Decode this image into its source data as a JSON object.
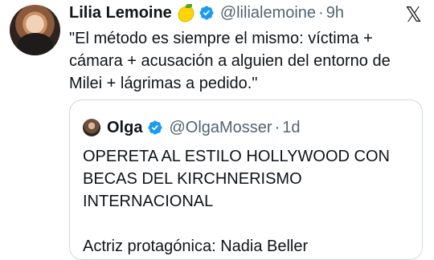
{
  "tweet": {
    "author_name": "Lilia Lemoine",
    "handle": "@lilialemoine",
    "separator": "·",
    "time": "9h",
    "text": "\"El método es siempre el mismo: víctima + cámara + acusación a alguien del entorno de Milei + lágrimas a pedido.\"",
    "badge_emoji": "lemon",
    "platform_logo": "𝕏"
  },
  "quoted_tweet": {
    "author_name": "Olga",
    "handle": "@OlgaMosser",
    "separator": "·",
    "time": "1d",
    "lines": [
      "OPERETA AL ESTILO HOLLYWOOD CON",
      "BECAS DEL KIRCHNERISMO",
      "INTERNACIONAL",
      "",
      "Actriz protagónica: Nadia Beller"
    ]
  },
  "colors": {
    "text": "#0f1419",
    "secondary": "#536471",
    "verified": "#1d9bf0",
    "border": "#cfd9de"
  }
}
